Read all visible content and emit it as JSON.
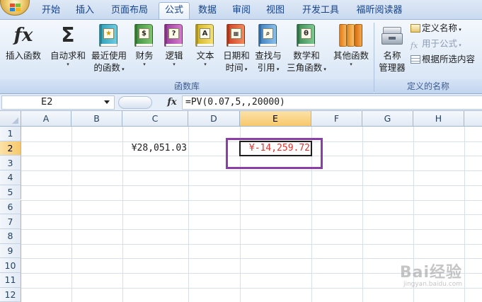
{
  "tabs": [
    {
      "label": "开始",
      "active": false
    },
    {
      "label": "插入",
      "active": false
    },
    {
      "label": "页面布局",
      "active": false
    },
    {
      "label": "公式",
      "active": true
    },
    {
      "label": "数据",
      "active": false
    },
    {
      "label": "审阅",
      "active": false
    },
    {
      "label": "视图",
      "active": false
    },
    {
      "label": "开发工具",
      "active": false
    },
    {
      "label": "福昕阅读器",
      "active": false
    }
  ],
  "ribbon": {
    "insert_function": {
      "label": "插入函数",
      "icon": "fx-icon"
    },
    "autosum": {
      "label": "自动求和",
      "icon": "sigma-icon"
    },
    "recent": {
      "line1": "最近使用",
      "line2": "的函数",
      "icon": "book-star-icon"
    },
    "finance": {
      "label": "财务",
      "icon": "book-finance-icon"
    },
    "logic": {
      "label": "逻辑",
      "icon": "book-question-icon"
    },
    "text": {
      "label": "文本",
      "icon": "book-text-icon"
    },
    "datetime": {
      "line1": "日期和",
      "line2": "时间",
      "icon": "book-calendar-icon"
    },
    "lookup": {
      "line1": "查找与",
      "line2": "引用",
      "icon": "book-magnifier-icon"
    },
    "math": {
      "line1": "数学和",
      "line2": "三角函数",
      "icon": "book-theta-icon"
    },
    "more": {
      "label": "其他函数",
      "icon": "books-icon"
    },
    "function_library_title": "函数库",
    "name_manager": {
      "line1": "名称",
      "line2": "管理器",
      "icon": "name-manager-icon"
    },
    "define_name": "定义名称",
    "use_in_formula": "用于公式",
    "create_from_selection": "根据所选内容",
    "defined_names_title": "定义的名称",
    "dropdown_glyph": "▾"
  },
  "formula_bar": {
    "name_box": "E2",
    "fx_label": "fx",
    "formula": "=PV(0.07,5,,20000)"
  },
  "sheet": {
    "columns": [
      "A",
      "B",
      "C",
      "D",
      "E",
      "F",
      "G",
      "H"
    ],
    "selected_column": "E",
    "rows": [
      "1",
      "2",
      "3",
      "4",
      "5",
      "6",
      "7",
      "8",
      "9",
      "10",
      "11",
      "12"
    ],
    "selected_row": "2",
    "cells": {
      "C2": "¥28,051.03",
      "E2": "¥-14,259.72"
    },
    "negative_color": "#e0312d",
    "highlight_color": "#8b3ea8"
  },
  "watermark": {
    "text": "Bai经验",
    "url": "jingyan.baidu.com"
  }
}
